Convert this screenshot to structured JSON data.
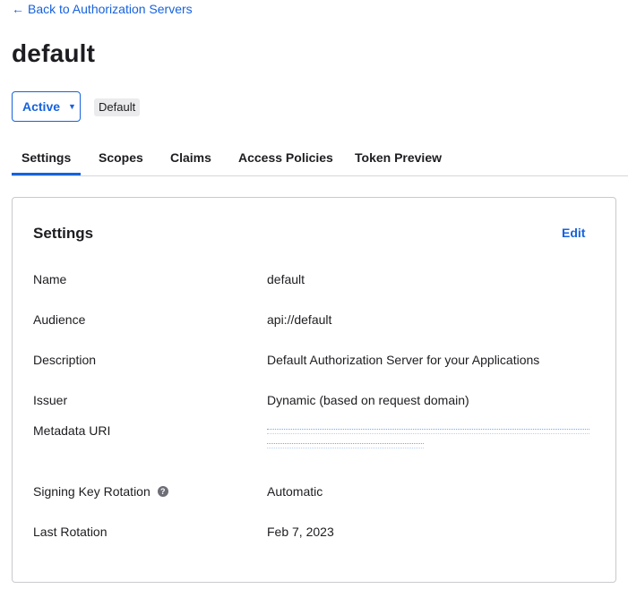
{
  "nav": {
    "back_link": "Back to Authorization Servers",
    "back_arrow": "←"
  },
  "header": {
    "title": "default",
    "status_label": "Active",
    "status_caret": "▼",
    "badge": "Default"
  },
  "tabs": [
    {
      "label": "Settings",
      "active": true
    },
    {
      "label": "Scopes"
    },
    {
      "label": "Claims"
    },
    {
      "label": "Access Policies"
    },
    {
      "label": "Token Preview"
    }
  ],
  "settings": {
    "title": "Settings",
    "edit_label": "Edit",
    "rows": [
      {
        "label": "Name",
        "value": "default"
      },
      {
        "label": "Audience",
        "value": "api://default"
      },
      {
        "label": "Description",
        "value": "Default Authorization Server for your Applications"
      },
      {
        "label": "Issuer",
        "value": "Dynamic (based on request domain)"
      },
      {
        "label": "Metadata URI",
        "value": ""
      },
      {
        "label": "Signing Key Rotation",
        "value": "Automatic"
      },
      {
        "label": "Last Rotation",
        "value": "Feb 7, 2023"
      }
    ],
    "help_icon_glyph": "?"
  },
  "colors": {
    "accent": "#1662dd",
    "text": "#1d1d21",
    "badge_bg": "#ebebed"
  }
}
